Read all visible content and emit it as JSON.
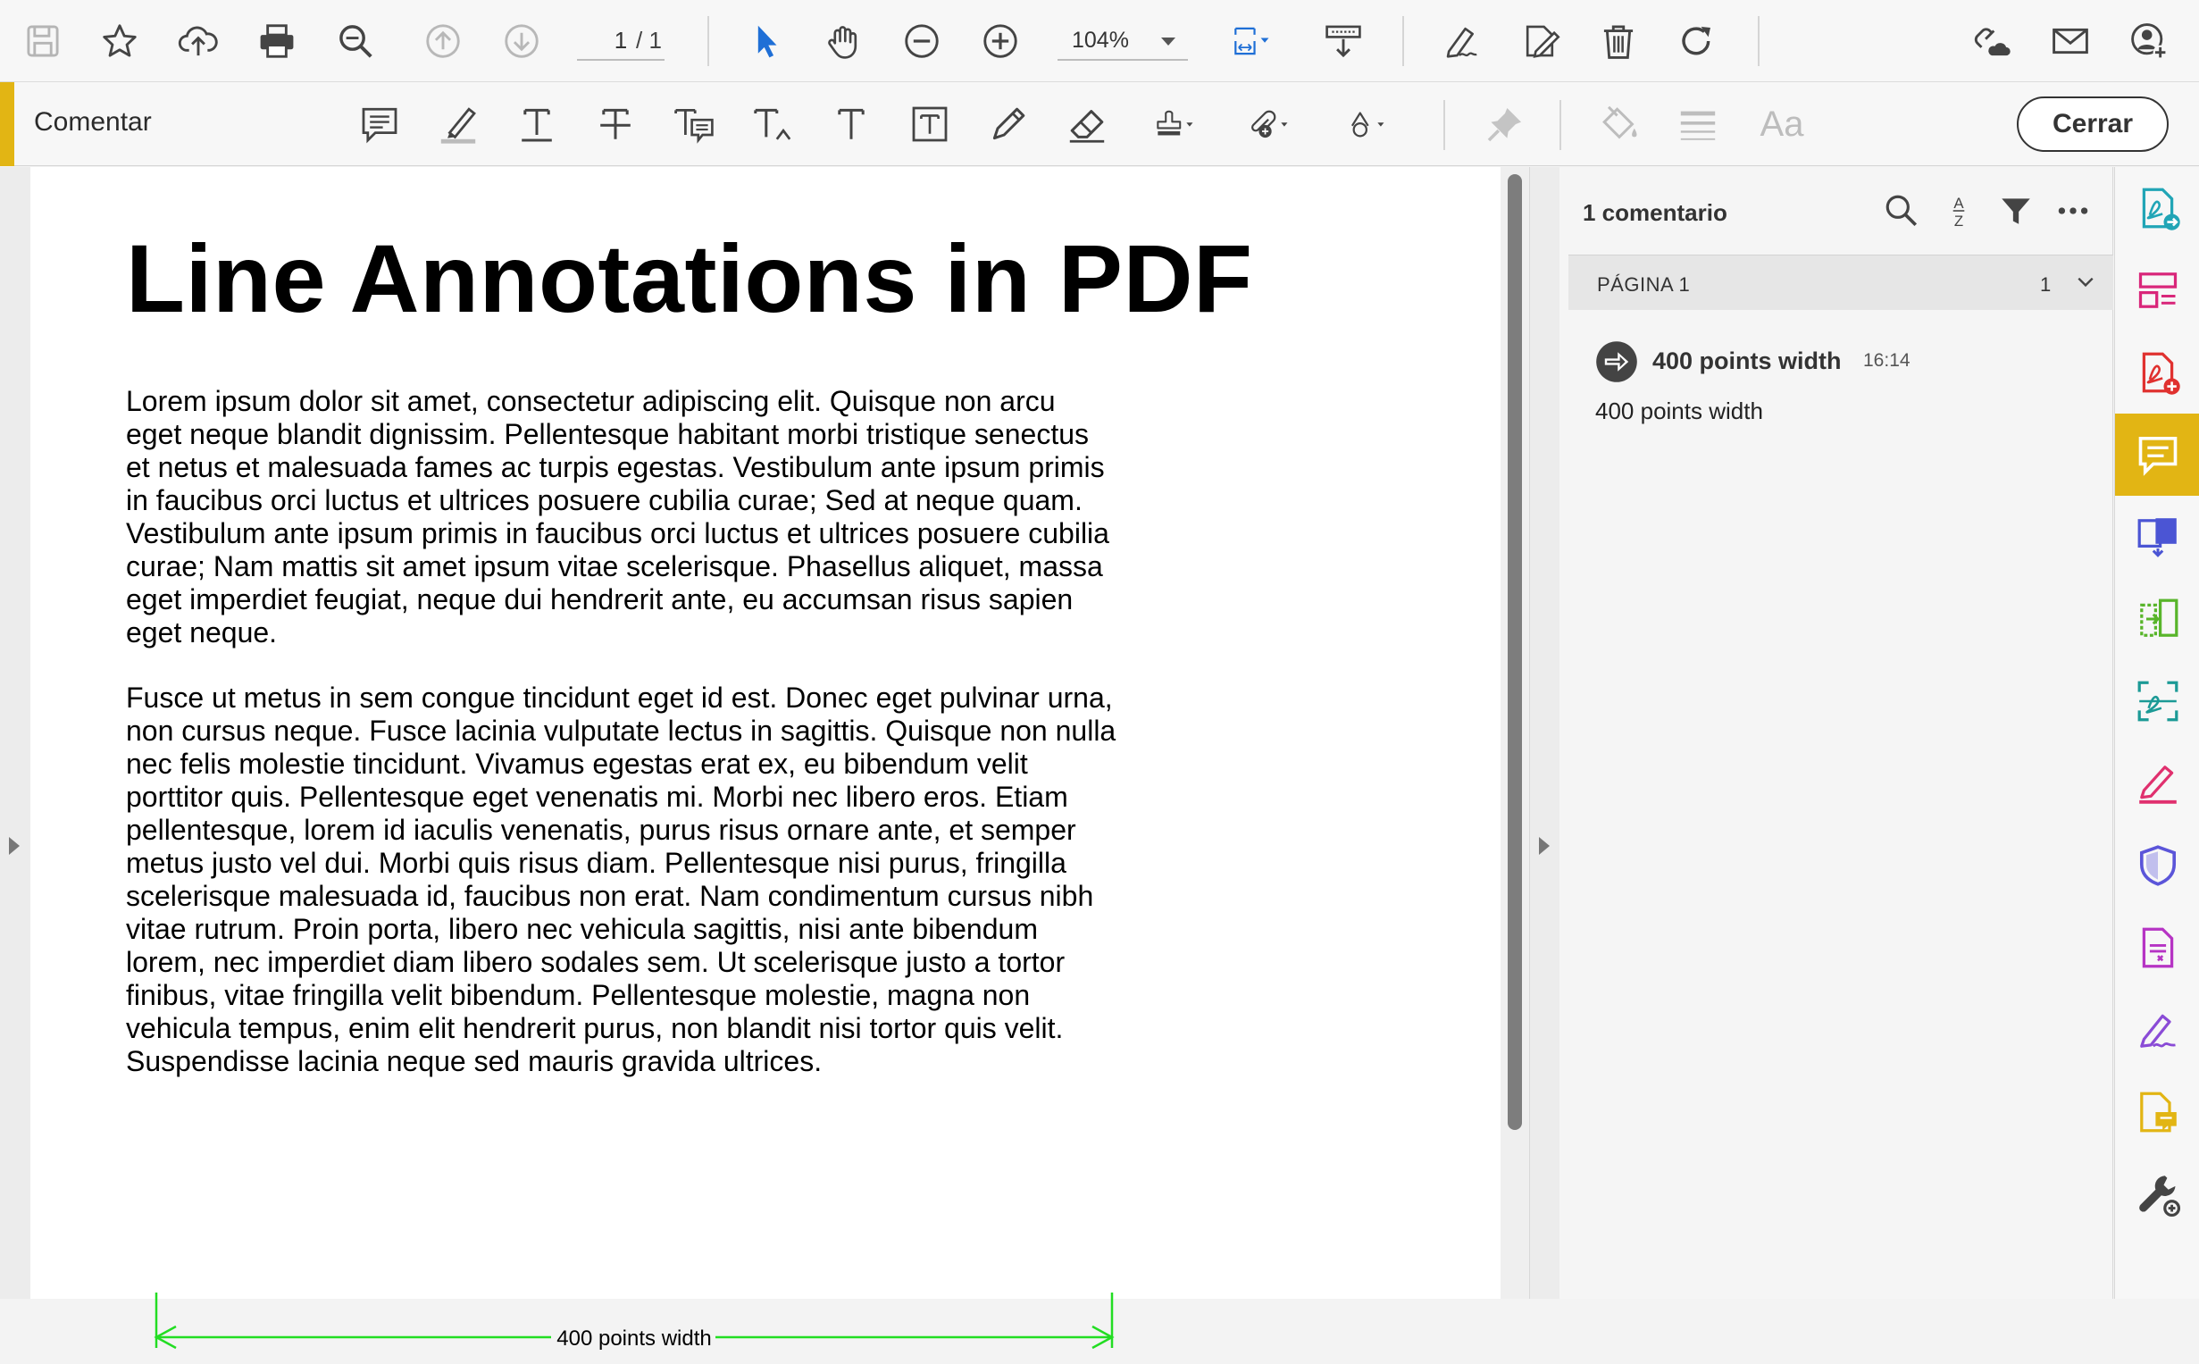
{
  "toolbar": {
    "page_current": "1",
    "page_total": "/ 1",
    "zoom": "104%"
  },
  "comment_toolbar": {
    "label": "Comentar",
    "close_label": "Cerrar",
    "text_style_label": "Aa"
  },
  "document": {
    "title": "Line Annotations in PDF",
    "paragraphs": [
      "Lorem ipsum dolor sit amet, consectetur adipiscing elit. Quisque non arcu eget neque blandit dignissim. Pellentesque habitant morbi tristique senectus et netus et malesuada fames ac turpis egestas. Vestibulum ante ipsum primis in faucibus orci luctus et ultrices posuere cubilia curae; Sed at neque quam. Vestibulum ante ipsum primis in faucibus orci luctus et ultrices posuere cubilia curae; Nam mattis sit amet ipsum vitae scelerisque. Phasellus aliquet, massa eget imperdiet feugiat, neque dui hendrerit ante, eu accumsan risus sapien eget neque.",
      "Fusce ut metus in sem congue tincidunt eget id est. Donec eget pulvinar urna, non cursus neque. Fusce lacinia vulputate lectus in sagittis. Quisque non nulla nec felis molestie tincidunt. Vivamus egestas erat ex, eu bibendum velit porttitor quis. Pellentesque eget venenatis mi. Morbi nec libero eros. Etiam pellentesque, lorem id iaculis venenatis, purus risus ornare ante, et semper metus justo vel dui. Morbi quis risus diam. Pellentesque nisi purus, fringilla scelerisque malesuada id, faucibus non erat. Nam condimentum cursus nibh vitae rutrum. Proin porta, libero nec vehicula sagittis, nisi ante bibendum lorem, nec imperdiet diam libero sodales sem. Ut scelerisque justo a tortor finibus, vitae fringilla velit bibendum. Pellentesque molestie, magna non vehicula tempus, enim elit hendrerit purus, non blandit nisi tortor quis velit. Suspendisse lacinia neque sed mauris gravida ultrices."
    ],
    "line_annotation": {
      "label": "400 points width",
      "color": "#22dd22"
    }
  },
  "comments_panel": {
    "count_label": "1 comentario",
    "page_group": {
      "label": "PÁGINA 1",
      "count": "1"
    },
    "items": [
      {
        "author": "400 points width",
        "time": "16:14",
        "text": "400 points width"
      }
    ]
  },
  "colors": {
    "accent": "#e2b514",
    "select_blue": "#1f6fd6"
  }
}
